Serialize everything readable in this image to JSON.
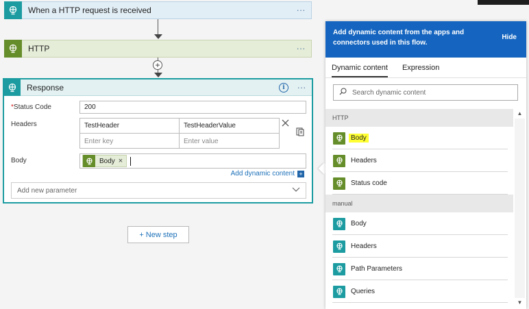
{
  "trigger": {
    "title": "When a HTTP request is received",
    "icon": "globe-icon",
    "color": "#1c9ca1"
  },
  "http_action": {
    "title": "HTTP",
    "icon": "globe-icon",
    "color": "#658d2a"
  },
  "card_menu": "···",
  "add_step_symbol": "+",
  "response": {
    "title": "Response",
    "info_icon_glyph": "i",
    "fields": {
      "status_required_mark": "*",
      "status_label": "Status Code",
      "status_value": "200",
      "headers_label": "Headers",
      "header_key": "TestHeader",
      "header_value": "TestHeaderValue",
      "key_placeholder": "Enter key",
      "value_placeholder": "Enter value",
      "body_label": "Body",
      "body_token": "Body",
      "token_remove": "×"
    },
    "add_dynamic_content": "Add dynamic content",
    "add_dynamic_badge": "+",
    "add_new_parameter": "Add new parameter"
  },
  "new_step_label": "+ New step",
  "panel": {
    "header": "Add dynamic content from the apps and connectors used in this flow.",
    "hide": "Hide",
    "tabs": [
      {
        "label": "Dynamic content",
        "active": true
      },
      {
        "label": "Expression",
        "active": false
      }
    ],
    "search_placeholder": "Search dynamic content",
    "sections": [
      {
        "title": "HTTP",
        "color": "#658d2a",
        "items": [
          {
            "label": "Body",
            "highlighted": true
          },
          {
            "label": "Headers",
            "highlighted": false
          },
          {
            "label": "Status code",
            "highlighted": false
          }
        ]
      },
      {
        "title": "manual",
        "color": "#1c9ca1",
        "items": [
          {
            "label": "Body",
            "highlighted": false
          },
          {
            "label": "Headers",
            "highlighted": false
          },
          {
            "label": "Path Parameters",
            "highlighted": false
          },
          {
            "label": "Queries",
            "highlighted": false
          }
        ]
      }
    ],
    "highlight_color": "#ffff33",
    "header_color": "#1565c0"
  }
}
